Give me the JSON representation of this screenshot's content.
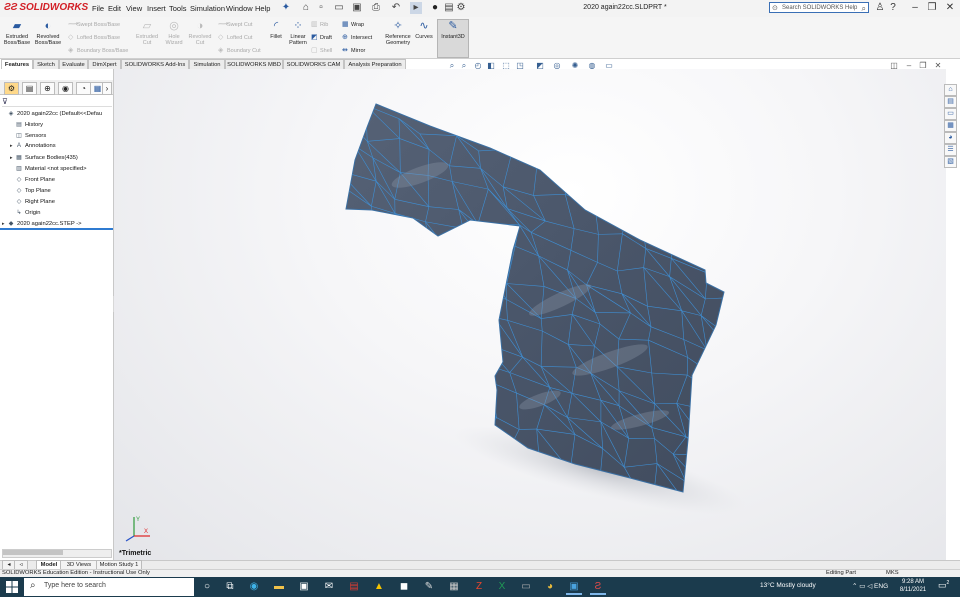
{
  "app": {
    "logo_text": "SOLIDWORKS",
    "menus": [
      "File",
      "Edit",
      "View",
      "Insert",
      "Tools",
      "Simulation",
      "Window",
      "Help"
    ],
    "document_title": "2020 again22cc.SLDPRT *",
    "search_placeholder": "Search SOLIDWORKS Help"
  },
  "commands": {
    "extruded_boss": "Extruded Boss/Base",
    "revolved_boss": "Revolved Boss/Base",
    "swept_boss": "Swept Boss/Base",
    "lofted_boss": "Lofted Boss/Base",
    "boundary_boss": "Boundary Boss/Base",
    "extruded_cut": "Extruded Cut",
    "hole_wizard": "Hole Wizard",
    "revolved_cut": "Revolved Cut",
    "swept_cut": "Swept Cut",
    "lofted_cut": "Lofted Cut",
    "boundary_cut": "Boundary Cut",
    "fillet": "Fillet",
    "linear_pattern": "Linear Pattern",
    "rib": "Rib",
    "draft": "Draft",
    "shell": "Shell",
    "wrap": "Wrap",
    "intersect": "Intersect",
    "mirror": "Mirror",
    "reference_geometry": "Reference Geometry",
    "curves": "Curves",
    "instant3d": "Instant3D"
  },
  "tabs": [
    "Features",
    "Sketch",
    "Evaluate",
    "DimXpert",
    "SOLIDWORKS Add-Ins",
    "Simulation",
    "SOLIDWORKS MBD",
    "SOLIDWORKS CAM",
    "Analysis Preparation"
  ],
  "active_tab": "Features",
  "tree": [
    {
      "label": "2020 again22cc  (Default<<Defau",
      "icon": "part-icon",
      "indent": 0,
      "expander": ""
    },
    {
      "label": "History",
      "icon": "history-icon",
      "indent": 1,
      "expander": ""
    },
    {
      "label": "Sensors",
      "icon": "sensor-icon",
      "indent": 1,
      "expander": ""
    },
    {
      "label": "Annotations",
      "icon": "annotation-icon",
      "indent": 1,
      "expander": "▸"
    },
    {
      "label": "Surface Bodies(435)",
      "icon": "surface-bodies-icon",
      "indent": 1,
      "expander": "▸"
    },
    {
      "label": "Material <not specified>",
      "icon": "material-icon",
      "indent": 1,
      "expander": ""
    },
    {
      "label": "Front Plane",
      "icon": "plane-icon",
      "indent": 1,
      "expander": ""
    },
    {
      "label": "Top Plane",
      "icon": "plane-icon",
      "indent": 1,
      "expander": ""
    },
    {
      "label": "Right Plane",
      "icon": "plane-icon",
      "indent": 1,
      "expander": ""
    },
    {
      "label": "Origin",
      "icon": "origin-icon",
      "indent": 1,
      "expander": ""
    },
    {
      "label": "2020 again22cc.STEP  ->",
      "icon": "imported-icon",
      "indent": 0,
      "expander": "▸"
    }
  ],
  "view": {
    "label": "*Trimetric"
  },
  "bottom_tabs": [
    "Model",
    "3D Views",
    "Motion Study 1"
  ],
  "active_bottom_tab": "Model",
  "status": {
    "text": "SOLIDWORKS Education Edition - Instructional Use Only",
    "editing": "Editing Part",
    "units": "MKS"
  },
  "taskbar": {
    "search_placeholder": "Type here to search",
    "weather": "13°C  Mostly cloudy",
    "language": "ENG",
    "time": "9:28 AM",
    "date": "8/11/2021",
    "notification_count": "2"
  },
  "colors": {
    "accent": "#2f7bd1",
    "mesh_fill": "#4b586b",
    "mesh_lines": "#3f8fd4",
    "taskbar": "#1b3b4d"
  }
}
